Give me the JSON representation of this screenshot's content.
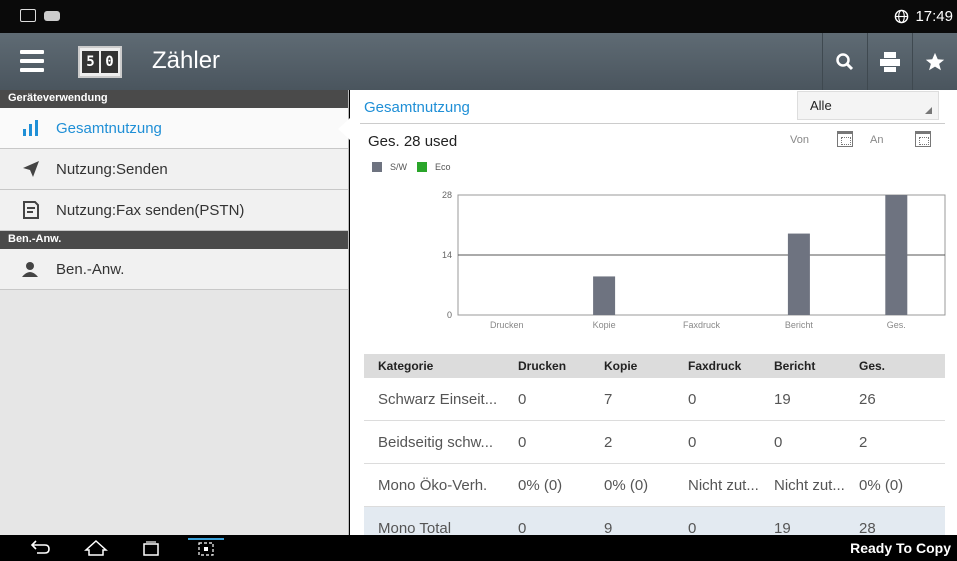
{
  "statusbar": {
    "time": "17:49"
  },
  "appbar": {
    "title": "Zähler",
    "logo_left": "5",
    "logo_right": "0"
  },
  "sidebar": {
    "section1": "Geräteverwendung",
    "items": [
      {
        "label": "Gesamtnutzung",
        "icon": "bar-chart-icon"
      },
      {
        "label": "Nutzung:Senden",
        "icon": "send-icon"
      },
      {
        "label": "Nutzung:Fax senden(PSTN)",
        "icon": "fax-doc-icon"
      }
    ],
    "section2": "Ben.-Anw.",
    "items2": [
      {
        "label": "Ben.-Anw.",
        "icon": "user-icon"
      }
    ]
  },
  "main": {
    "title": "Gesamtnutzung",
    "filter": "Alle",
    "total_text": "Ges. 28 used",
    "von": "Von",
    "an": "An"
  },
  "chart_data": {
    "type": "bar",
    "legend": [
      "S/W",
      "Eco"
    ],
    "series_colors": {
      "S/W": "#6e7380",
      "Eco": "#2aa52a"
    },
    "categories": [
      "Drucken",
      "Kopie",
      "Faxdruck",
      "Bericht",
      "Ges."
    ],
    "series": [
      {
        "name": "S/W",
        "values": [
          0,
          9,
          0,
          19,
          28
        ]
      }
    ],
    "yticks": [
      "0",
      "14",
      "28"
    ],
    "ylim": [
      0,
      28
    ],
    "grid": true
  },
  "table": {
    "headers": [
      "Kategorie",
      "Drucken",
      "Kopie",
      "Faxdruck",
      "Bericht",
      "Ges."
    ],
    "rows": [
      [
        "Schwarz Einseit...",
        "0",
        "7",
        "0",
        "19",
        "26"
      ],
      [
        "Beidseitig schw...",
        "0",
        "2",
        "0",
        "0",
        "2"
      ],
      [
        "Mono Öko-Verh.",
        "0% (0)",
        "0% (0)",
        "Nicht zut...",
        "Nicht zut...",
        "0% (0)"
      ],
      [
        "Mono Total",
        "0",
        "9",
        "0",
        "19",
        "28"
      ]
    ]
  },
  "navbar": {
    "status": "Ready To Copy"
  }
}
